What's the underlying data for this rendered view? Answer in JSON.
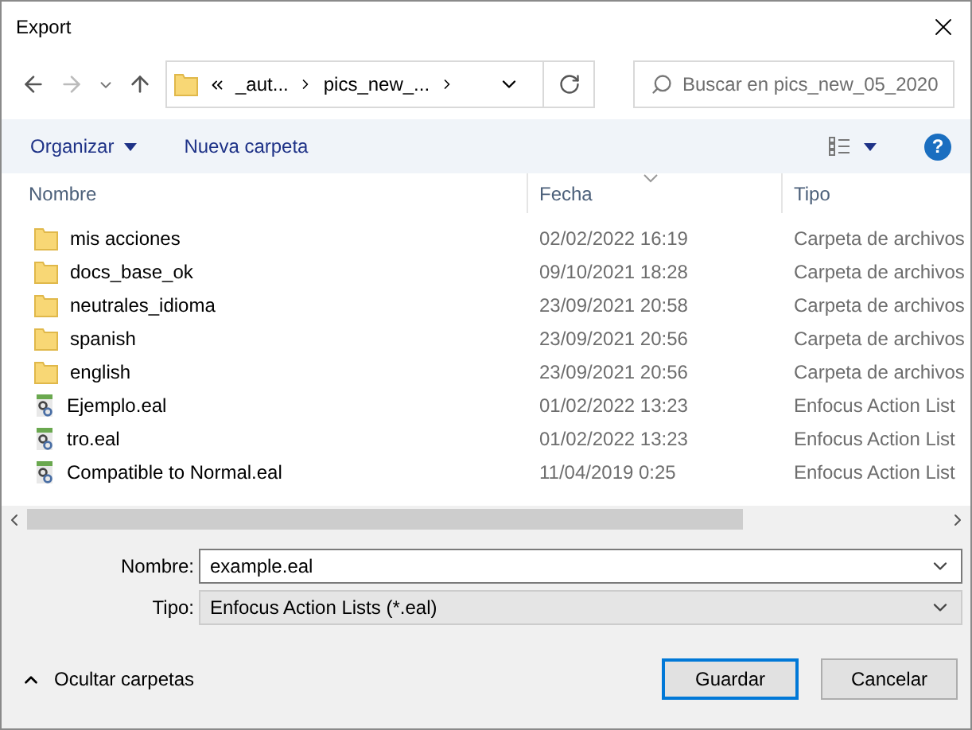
{
  "window": {
    "title": "Export"
  },
  "nav": {
    "path": [
      "_aut...",
      "pics_new_..."
    ],
    "search_placeholder": "Buscar en pics_new_05_2020"
  },
  "toolbar": {
    "organize": "Organizar",
    "new_folder": "Nueva carpeta",
    "help": "?"
  },
  "columns": [
    {
      "label": "Nombre",
      "sorted": false
    },
    {
      "label": "Fecha",
      "sorted": true
    },
    {
      "label": "Tipo",
      "sorted": false
    }
  ],
  "rows": [
    {
      "kind": "folder",
      "name": "mis acciones",
      "date": "02/02/2022 16:19",
      "type": "Carpeta de archivos"
    },
    {
      "kind": "folder",
      "name": "docs_base_ok",
      "date": "09/10/2021 18:28",
      "type": "Carpeta de archivos"
    },
    {
      "kind": "folder",
      "name": "neutrales_idioma",
      "date": "23/09/2021 20:58",
      "type": "Carpeta de archivos"
    },
    {
      "kind": "folder",
      "name": "spanish",
      "date": "23/09/2021 20:56",
      "type": "Carpeta de archivos"
    },
    {
      "kind": "folder",
      "name": "english",
      "date": "23/09/2021 20:56",
      "type": "Carpeta de archivos"
    },
    {
      "kind": "file",
      "name": "Ejemplo.eal",
      "date": "01/02/2022 13:23",
      "type": "Enfocus Action List"
    },
    {
      "kind": "file",
      "name": "tro.eal",
      "date": "01/02/2022 13:23",
      "type": "Enfocus Action List"
    },
    {
      "kind": "file",
      "name": "Compatible to Normal.eal",
      "date": "11/04/2019 0:25",
      "type": "Enfocus Action List"
    }
  ],
  "filename": {
    "label": "Nombre:",
    "value": "example.eal"
  },
  "filetype": {
    "label": "Tipo:",
    "value": "Enfocus Action Lists (*.eal)"
  },
  "hide_folders": "Ocultar carpetas",
  "buttons": [
    {
      "label": "Guardar",
      "default": true
    },
    {
      "label": "Cancelar",
      "default": false
    }
  ]
}
